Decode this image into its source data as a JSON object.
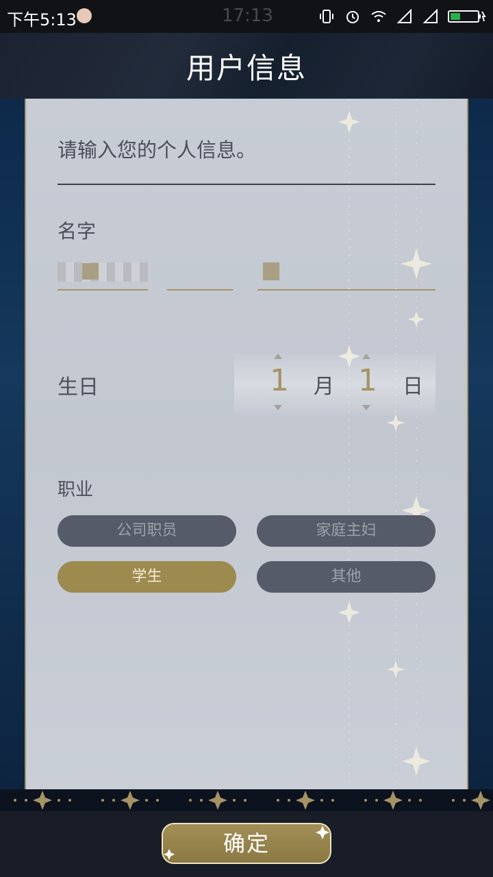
{
  "status_bar": {
    "time_left": "下午5:13",
    "time_center": "17:13"
  },
  "header": {
    "title": "用户信息"
  },
  "form": {
    "prompt": "请输入您的个人信息。",
    "name_label": "名字",
    "birthday": {
      "label": "生日",
      "month_value": "1",
      "month_unit": "月",
      "day_value": "1",
      "day_unit": "日"
    },
    "occupation": {
      "label": "职业",
      "options": [
        "公司职员",
        "家庭主妇",
        "学生",
        "其他"
      ],
      "selected": "学生"
    }
  },
  "confirm_label": "确定",
  "colors": {
    "accent_gold": "#9d8a4f",
    "option_gray": "#555b68",
    "card_bg": "#c7ccd5"
  }
}
